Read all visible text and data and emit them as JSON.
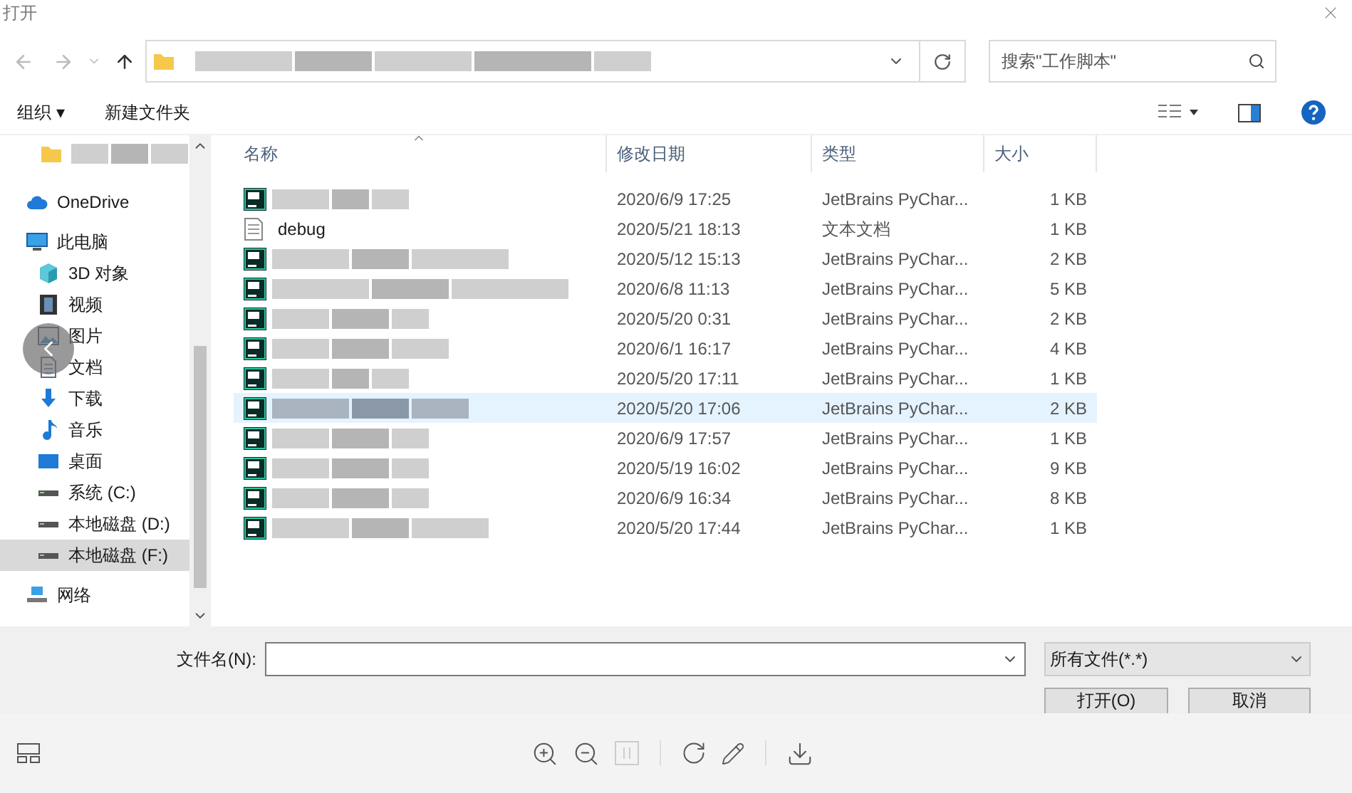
{
  "window": {
    "title": "打开"
  },
  "address": {
    "kind": "redacted"
  },
  "search": {
    "placeholder": "搜索\"工作脚本\""
  },
  "toolbar": {
    "organize": "组织 ▾",
    "new_folder": "新建文件夹"
  },
  "sidebar": {
    "items": [
      {
        "kind": "redacted",
        "selected": false
      },
      {
        "kind": "text",
        "label": "OneDrive",
        "selected": false
      },
      {
        "kind": "text",
        "label": "此电脑",
        "selected": false
      },
      {
        "kind": "text",
        "label": "3D 对象",
        "selected": false
      },
      {
        "kind": "text",
        "label": "视频",
        "selected": false
      },
      {
        "kind": "text",
        "label": "图片",
        "selected": false
      },
      {
        "kind": "text",
        "label": "文档",
        "selected": false
      },
      {
        "kind": "text",
        "label": "下载",
        "selected": false
      },
      {
        "kind": "text",
        "label": "音乐",
        "selected": false
      },
      {
        "kind": "text",
        "label": "桌面",
        "selected": false
      },
      {
        "kind": "text",
        "label": "系统 (C:)",
        "selected": false
      },
      {
        "kind": "text",
        "label": "本地磁盘 (D:)",
        "selected": false
      },
      {
        "kind": "text",
        "label": "本地磁盘 (F:)",
        "selected": true
      },
      {
        "kind": "text",
        "label": "网络",
        "selected": false
      }
    ]
  },
  "table": {
    "columns": [
      "名称",
      "修改日期",
      "类型",
      "大小"
    ],
    "rows": [
      {
        "kind": "redacted",
        "date": "2020/6/9 17:25",
        "type": "JetBrains PyChar...",
        "size": "1 KB",
        "selected": false
      },
      {
        "kind": "text",
        "name": "debug",
        "date": "2020/5/21 18:13",
        "type": "文本文档",
        "size": "1 KB",
        "selected": false
      },
      {
        "kind": "redacted",
        "date": "2020/5/12 15:13",
        "type": "JetBrains PyChar...",
        "size": "2 KB",
        "selected": false
      },
      {
        "kind": "redacted",
        "date": "2020/6/8 11:13",
        "type": "JetBrains PyChar...",
        "size": "5 KB",
        "selected": false
      },
      {
        "kind": "redacted",
        "date": "2020/5/20 0:31",
        "type": "JetBrains PyChar...",
        "size": "2 KB",
        "selected": false
      },
      {
        "kind": "redacted",
        "date": "2020/6/1 16:17",
        "type": "JetBrains PyChar...",
        "size": "4 KB",
        "selected": false
      },
      {
        "kind": "redacted",
        "date": "2020/5/20 17:11",
        "type": "JetBrains PyChar...",
        "size": "1 KB",
        "selected": false
      },
      {
        "kind": "redacted",
        "date": "2020/5/20 17:06",
        "type": "JetBrains PyChar...",
        "size": "2 KB",
        "selected": true
      },
      {
        "kind": "redacted",
        "date": "2020/6/9 17:57",
        "type": "JetBrains PyChar...",
        "size": "1 KB",
        "selected": false
      },
      {
        "kind": "redacted",
        "date": "2020/5/19 16:02",
        "type": "JetBrains PyChar...",
        "size": "9 KB",
        "selected": false
      },
      {
        "kind": "redacted",
        "date": "2020/6/9 16:34",
        "type": "JetBrains PyChar...",
        "size": "8 KB",
        "selected": false
      },
      {
        "kind": "redacted",
        "date": "2020/5/20 17:44",
        "type": "JetBrains PyChar...",
        "size": "1 KB",
        "selected": false
      }
    ]
  },
  "footer": {
    "filename_label": "文件名(N):",
    "filter": "所有文件(*.*)",
    "open": "打开(O)",
    "cancel": "取消"
  }
}
